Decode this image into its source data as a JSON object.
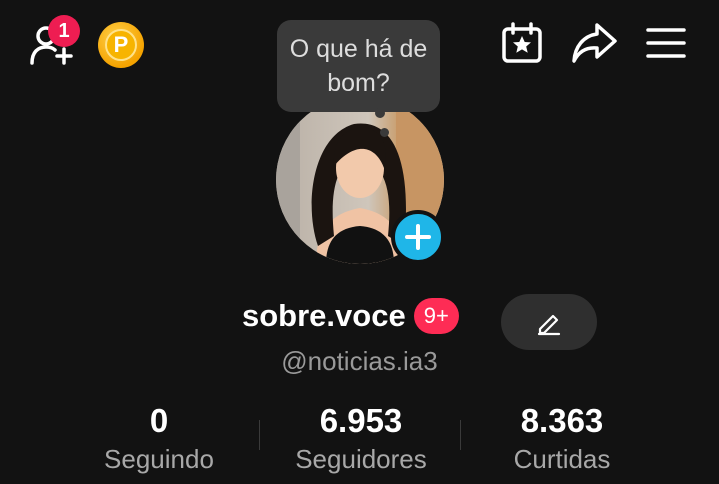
{
  "top_bar": {
    "add_friend_badge": "1",
    "coin_letter": "P",
    "icons": [
      "add-friend-icon",
      "coin-icon",
      "calendar-star-icon",
      "share-icon",
      "menu-icon"
    ]
  },
  "bubble": {
    "text": "O que há de bom?"
  },
  "profile": {
    "username": "sobre.voce",
    "notif_badge": "9+",
    "handle": "@noticias.ia3"
  },
  "stats": [
    {
      "value": "0",
      "label": "Seguindo"
    },
    {
      "value": "6.953",
      "label": "Seguidores"
    },
    {
      "value": "8.363",
      "label": "Curtidas"
    }
  ],
  "colors": {
    "background": "#121212",
    "accent_red": "#fe2c55",
    "accent_blue": "#1fb6e8",
    "coin": "#f7b400"
  }
}
